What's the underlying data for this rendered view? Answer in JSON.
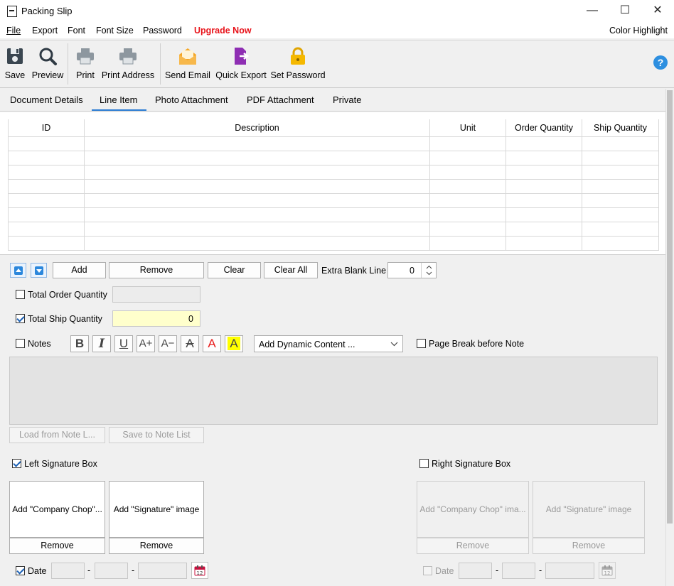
{
  "window": {
    "title": "Packing Slip",
    "minimize": "—",
    "maximize": "☐",
    "close": "✕"
  },
  "menu": {
    "file": "File",
    "export": "Export",
    "font": "Font",
    "font_size": "Font Size",
    "password": "Password",
    "upgrade": "Upgrade Now",
    "color_highlight": "Color Highlight"
  },
  "toolbar": {
    "save": "Save",
    "preview": "Preview",
    "print": "Print",
    "print_address": "Print Address",
    "send_email": "Send Email",
    "quick_export": "Quick Export",
    "set_password": "Set Password",
    "help": "?"
  },
  "tabs": {
    "document_details": "Document Details",
    "line_item": "Line Item",
    "photo_attachment": "Photo Attachment",
    "pdf_attachment": "PDF Attachment",
    "private": "Private"
  },
  "grid": {
    "headers": [
      "ID",
      "Description",
      "Unit",
      "Order Quantity",
      "Ship Quantity"
    ]
  },
  "controls": {
    "add": "Add",
    "remove": "Remove",
    "clear": "Clear",
    "clear_all": "Clear All",
    "extra_blank_line_label": "Extra Blank Line",
    "extra_blank_line_value": "0",
    "total_order_quantity": "Total Order Quantity",
    "total_ship_quantity": "Total Ship Quantity",
    "total_ship_quantity_value": "0",
    "notes": "Notes",
    "dynamic_content": "Add Dynamic Content ...",
    "page_break": "Page Break before Note",
    "load_note": "Load from Note L...",
    "save_note": "Save to Note List"
  },
  "format": {
    "bold": "B",
    "italic": "I",
    "underline": "U",
    "grow": "A+",
    "shrink": "A−",
    "strike": "A",
    "font_color": "A",
    "highlight": "A"
  },
  "signature": {
    "left_label": "Left Signature Box",
    "right_label": "Right Signature Box",
    "chop_left": "Add \"Company Chop\"...",
    "sig_left": "Add \"Signature\" image",
    "chop_right": "Add \"Company Chop\" ima...",
    "sig_right": "Add \"Signature\" image",
    "remove": "Remove",
    "date": "Date",
    "dash": "-"
  },
  "colors": {
    "accent": "#2b7cd3",
    "upgrade": "#e8141b",
    "ship_qty_bg": "#ffffcc"
  }
}
